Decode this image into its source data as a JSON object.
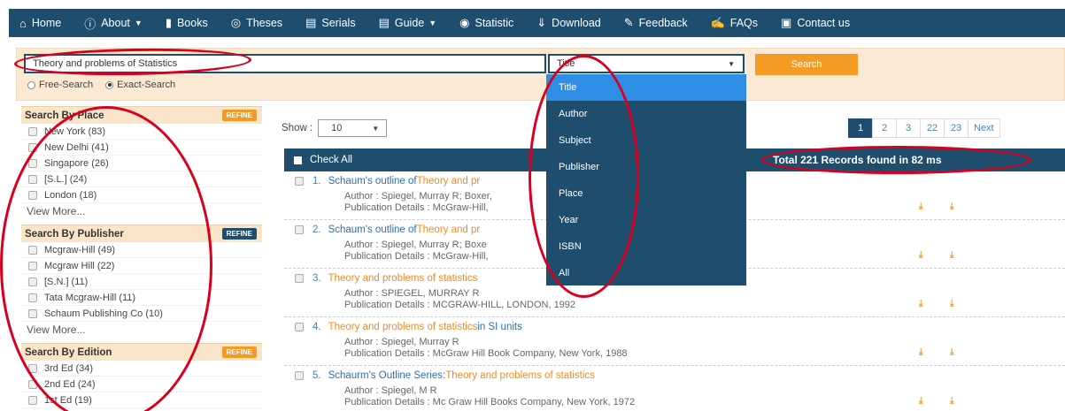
{
  "navbar": {
    "items": [
      {
        "label": "Home",
        "icon": "home-icon"
      },
      {
        "label": "About",
        "icon": "info-icon",
        "dropdown": true
      },
      {
        "label": "Books",
        "icon": "book-icon"
      },
      {
        "label": "Theses",
        "icon": "target-icon"
      },
      {
        "label": "Serials",
        "icon": "serials-icon"
      },
      {
        "label": "Guide",
        "icon": "guide-icon",
        "dropdown": true
      },
      {
        "label": "Statistic",
        "icon": "statistic-icon"
      },
      {
        "label": "Download",
        "icon": "download-icon"
      },
      {
        "label": "Feedback",
        "icon": "pencil-icon"
      },
      {
        "label": "FAQs",
        "icon": "edit-icon"
      },
      {
        "label": "Contact us",
        "icon": "contact-icon"
      }
    ]
  },
  "search": {
    "query": "Theory and problems of Statistics",
    "field_selected": "Title",
    "button_label": "Search",
    "modes": [
      {
        "label": "Free-Search",
        "checked": false
      },
      {
        "label": "Exact-Search",
        "checked": true
      }
    ],
    "field_options": [
      "Title",
      "Author",
      "Subject",
      "Publisher",
      "Place",
      "Year",
      "ISBN",
      "All"
    ]
  },
  "sidebar": {
    "place": {
      "title": "Search By Place",
      "refine": "REFINE",
      "items": [
        "New York (83)",
        "New Delhi (41)",
        "Singapore (26)",
        "[S.L.] (24)",
        "London (18)"
      ],
      "view_more": "View More..."
    },
    "publisher": {
      "title": "Search By Publisher",
      "refine": "REFINE",
      "items": [
        "Mcgraw-Hill (49)",
        "Mcgraw Hill (22)",
        "[S.N.] (11)",
        "Tata Mcgraw-Hill (11)",
        "Schaum Publishing Co (10)"
      ],
      "view_more": "View More..."
    },
    "edition": {
      "title": "Search By Edition",
      "refine": "REFINE",
      "items": [
        "3rd Ed (34)",
        "2nd Ed (24)",
        "1st Ed (19)"
      ]
    }
  },
  "main": {
    "show_label": "Show :",
    "show_value": "10",
    "pages": [
      "1",
      "2",
      "3",
      "22",
      "23",
      "Next"
    ],
    "check_all": "Check All",
    "total": "Total 221 Records found in 82 ms",
    "results": [
      {
        "num": "1.",
        "pre": "Schaum's outline of ",
        "hl": "Theory and pr",
        "post": "",
        "author": "Author : Spiegel, Murray R; Boxer,",
        "pub": "Publication Details : McGraw-Hill,"
      },
      {
        "num": "2.",
        "pre": "Schaum's outline of ",
        "hl": "Theory and pr",
        "post": "",
        "author": "Author : Spiegel, Murray R; Boxe",
        "pub": "Publication Details : McGraw-Hill,"
      },
      {
        "num": "3.",
        "pre": "",
        "hl": "Theory and problems of statistics",
        "post": "",
        "author": "Author : SPIEGEL, MURRAY R",
        "pub": "Publication Details : MCGRAW-HILL, LONDON, 1992"
      },
      {
        "num": "4.",
        "pre": "",
        "hl": "Theory and problems of statistics",
        "post": " in SI units",
        "author": "Author : Spiegel, Murray R",
        "pub": "Publication Details : McGraw Hill Book Company, New York, 1988"
      },
      {
        "num": "5.",
        "pre": "Schaurm's Outline Series: ",
        "hl": "Theory and problems of statistics",
        "post": "",
        "author": "Author : Spiegel, M R",
        "pub": "Publication Details : Mc Graw Hill Books Company, New York, 1972"
      }
    ]
  },
  "colors": {
    "navbar": "#1e4d6e",
    "accent_orange": "#f59a23",
    "annotation_red": "#d8001e",
    "active_option": "#2e8ee6"
  }
}
